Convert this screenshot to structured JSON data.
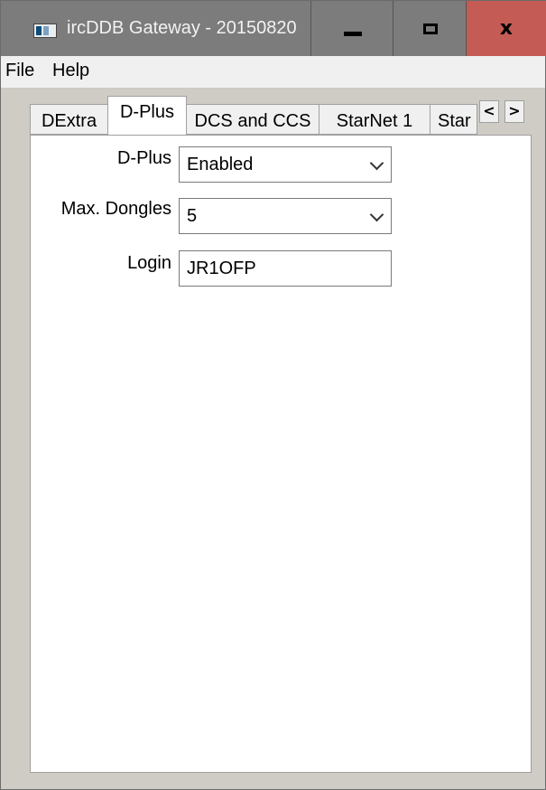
{
  "window": {
    "title": "ircDDB Gateway - 20150820",
    "app_icon": "app-window-icon",
    "controls": {
      "minimize_icon": "minimize-icon",
      "maximize_icon": "maximize-icon",
      "close_icon": "close-icon",
      "close_glyph": "x",
      "close_color": "#c45c55"
    }
  },
  "menu": {
    "file": "File",
    "help": "Help"
  },
  "tabs": [
    {
      "label": "DExtra",
      "active": false
    },
    {
      "label": "D-Plus",
      "active": true
    },
    {
      "label": "DCS and CCS",
      "active": false
    },
    {
      "label": "StarNet 1",
      "active": false
    },
    {
      "label": "Star",
      "active": false
    }
  ],
  "tab_scroll": {
    "left": "<",
    "right": ">"
  },
  "form": {
    "dplus_label": "D-Plus",
    "dplus_value": "Enabled",
    "dongles_label": "Max. Dongles",
    "dongles_value": "5",
    "login_label": "Login",
    "login_value": "JR1OFP"
  }
}
